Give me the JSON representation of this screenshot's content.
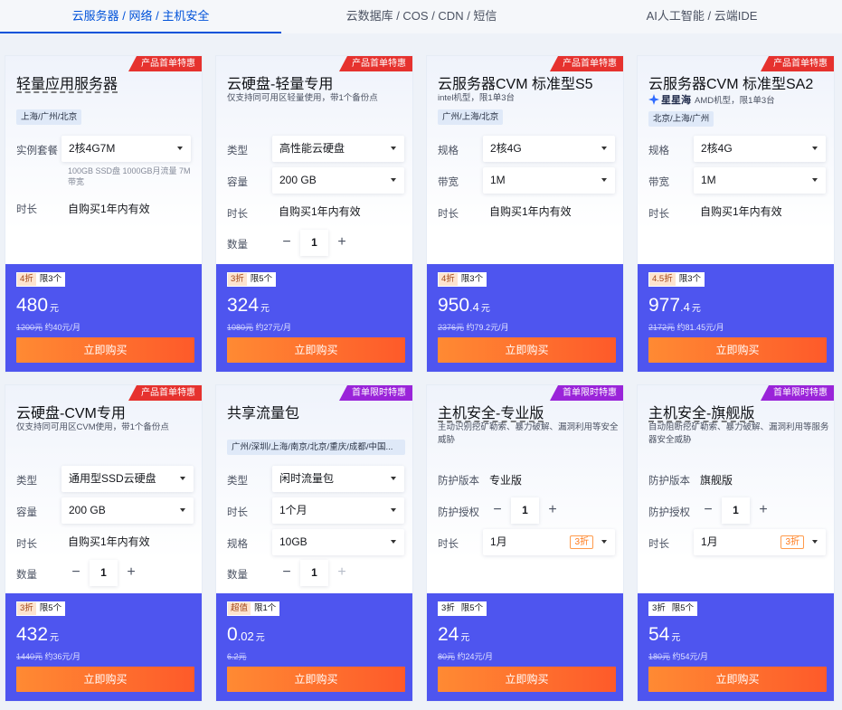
{
  "tabs": [
    {
      "label": "云服务器 / 网络 / 主机安全"
    },
    {
      "label": "云数据库 / COS / CDN / 短信"
    },
    {
      "label": "AI人工智能 / 云端IDE"
    }
  ],
  "ribbons": {
    "red": "产品首单特惠",
    "purple": "首单限时特惠"
  },
  "labels": {
    "instance": "实例套餐",
    "duration": "时长",
    "type": "类型",
    "capacity": "容量",
    "quantity": "数量",
    "spec": "规格",
    "bandwidth": "带宽",
    "protect_version": "防护版本",
    "protect_auth": "防护授权"
  },
  "buy_label": "立即购买",
  "cards": [
    {
      "title": "轻量应用服务器",
      "region": "上海/广州/北京",
      "package": "2核4G7M",
      "package_note": "100GB SSD盘 1000GB月流量 7M带宽",
      "duration_text": "自购买1年内有效",
      "discount": "4折",
      "limit": "限3个",
      "price_int": "480",
      "price_dec": "",
      "unit": "元",
      "orig_price": "1200元",
      "per_month": "约40元/月"
    },
    {
      "title": "云硬盘-轻量专用",
      "subtitle": "仅支持同可用区轻量使用，带1个备份点",
      "type_value": "高性能云硬盘",
      "capacity_value": "200 GB",
      "duration_text": "自购买1年内有效",
      "quantity": "1",
      "discount": "3折",
      "limit": "限5个",
      "price_int": "324",
      "price_dec": "",
      "unit": "元",
      "orig_price": "1080元",
      "per_month": "约27元/月"
    },
    {
      "title": "云服务器CVM 标准型S5",
      "subtitle": "intel机型，限1单3台",
      "region": "广州/上海/北京",
      "spec_value": "2核4G",
      "bandwidth_value": "1M",
      "duration_text": "自购买1年内有效",
      "discount": "4折",
      "limit": "限3个",
      "price_int": "950",
      "price_dec": ".4",
      "unit": "元",
      "orig_price": "2376元",
      "per_month": "约79.2元/月"
    },
    {
      "title": "云服务器CVM 标准型SA2",
      "brand": "星星海",
      "subtitle": "AMD机型，限1单3台",
      "region": "北京/上海/广州",
      "spec_value": "2核4G",
      "bandwidth_value": "1M",
      "duration_text": "自购买1年内有效",
      "discount": "4.5折",
      "limit": "限3个",
      "price_int": "977",
      "price_dec": ".4",
      "unit": "元",
      "orig_price": "2172元",
      "per_month": "约81.45元/月"
    },
    {
      "title": "云硬盘-CVM专用",
      "subtitle": "仅支持同可用区CVM使用，带1个备份点",
      "type_value": "通用型SSD云硬盘",
      "capacity_value": "200 GB",
      "duration_text": "自购买1年内有效",
      "quantity": "1",
      "discount": "3折",
      "limit": "限5个",
      "price_int": "432",
      "price_dec": "",
      "unit": "元",
      "orig_price": "1440元",
      "per_month": "约36元/月"
    },
    {
      "title": "共享流量包",
      "region": "广州/深圳/上海/南京/北京/重庆/成都/中国...",
      "type_value": "闲时流量包",
      "duration_value": "1个月",
      "spec_value": "10GB",
      "quantity": "1",
      "discount": "超值",
      "limit": "限1个",
      "price_int": "0",
      "price_dec": ".02",
      "unit": "元",
      "orig_price": "6.2元",
      "per_month": ""
    },
    {
      "title": "主机安全-专业版",
      "subtitle": "主动识别挖矿勒索、暴力破解、漏洞利用等安全威胁",
      "protect_version": "专业版",
      "quantity": "1",
      "duration_value": "1月",
      "duration_disc": "3折",
      "discount": "3折",
      "limit": "限5个",
      "price_int": "24",
      "price_dec": "",
      "unit": "元",
      "orig_price": "80元",
      "per_month": "约24元/月"
    },
    {
      "title": "主机安全-旗舰版",
      "subtitle": "自动阻断挖矿勒索、暴力破解、漏洞利用等服务器安全威胁",
      "protect_version": "旗舰版",
      "quantity": "1",
      "duration_value": "1月",
      "duration_disc": "3折",
      "discount": "3折",
      "limit": "限5个",
      "price_int": "54",
      "price_dec": "",
      "unit": "元",
      "orig_price": "180元",
      "per_month": "约54元/月"
    }
  ]
}
